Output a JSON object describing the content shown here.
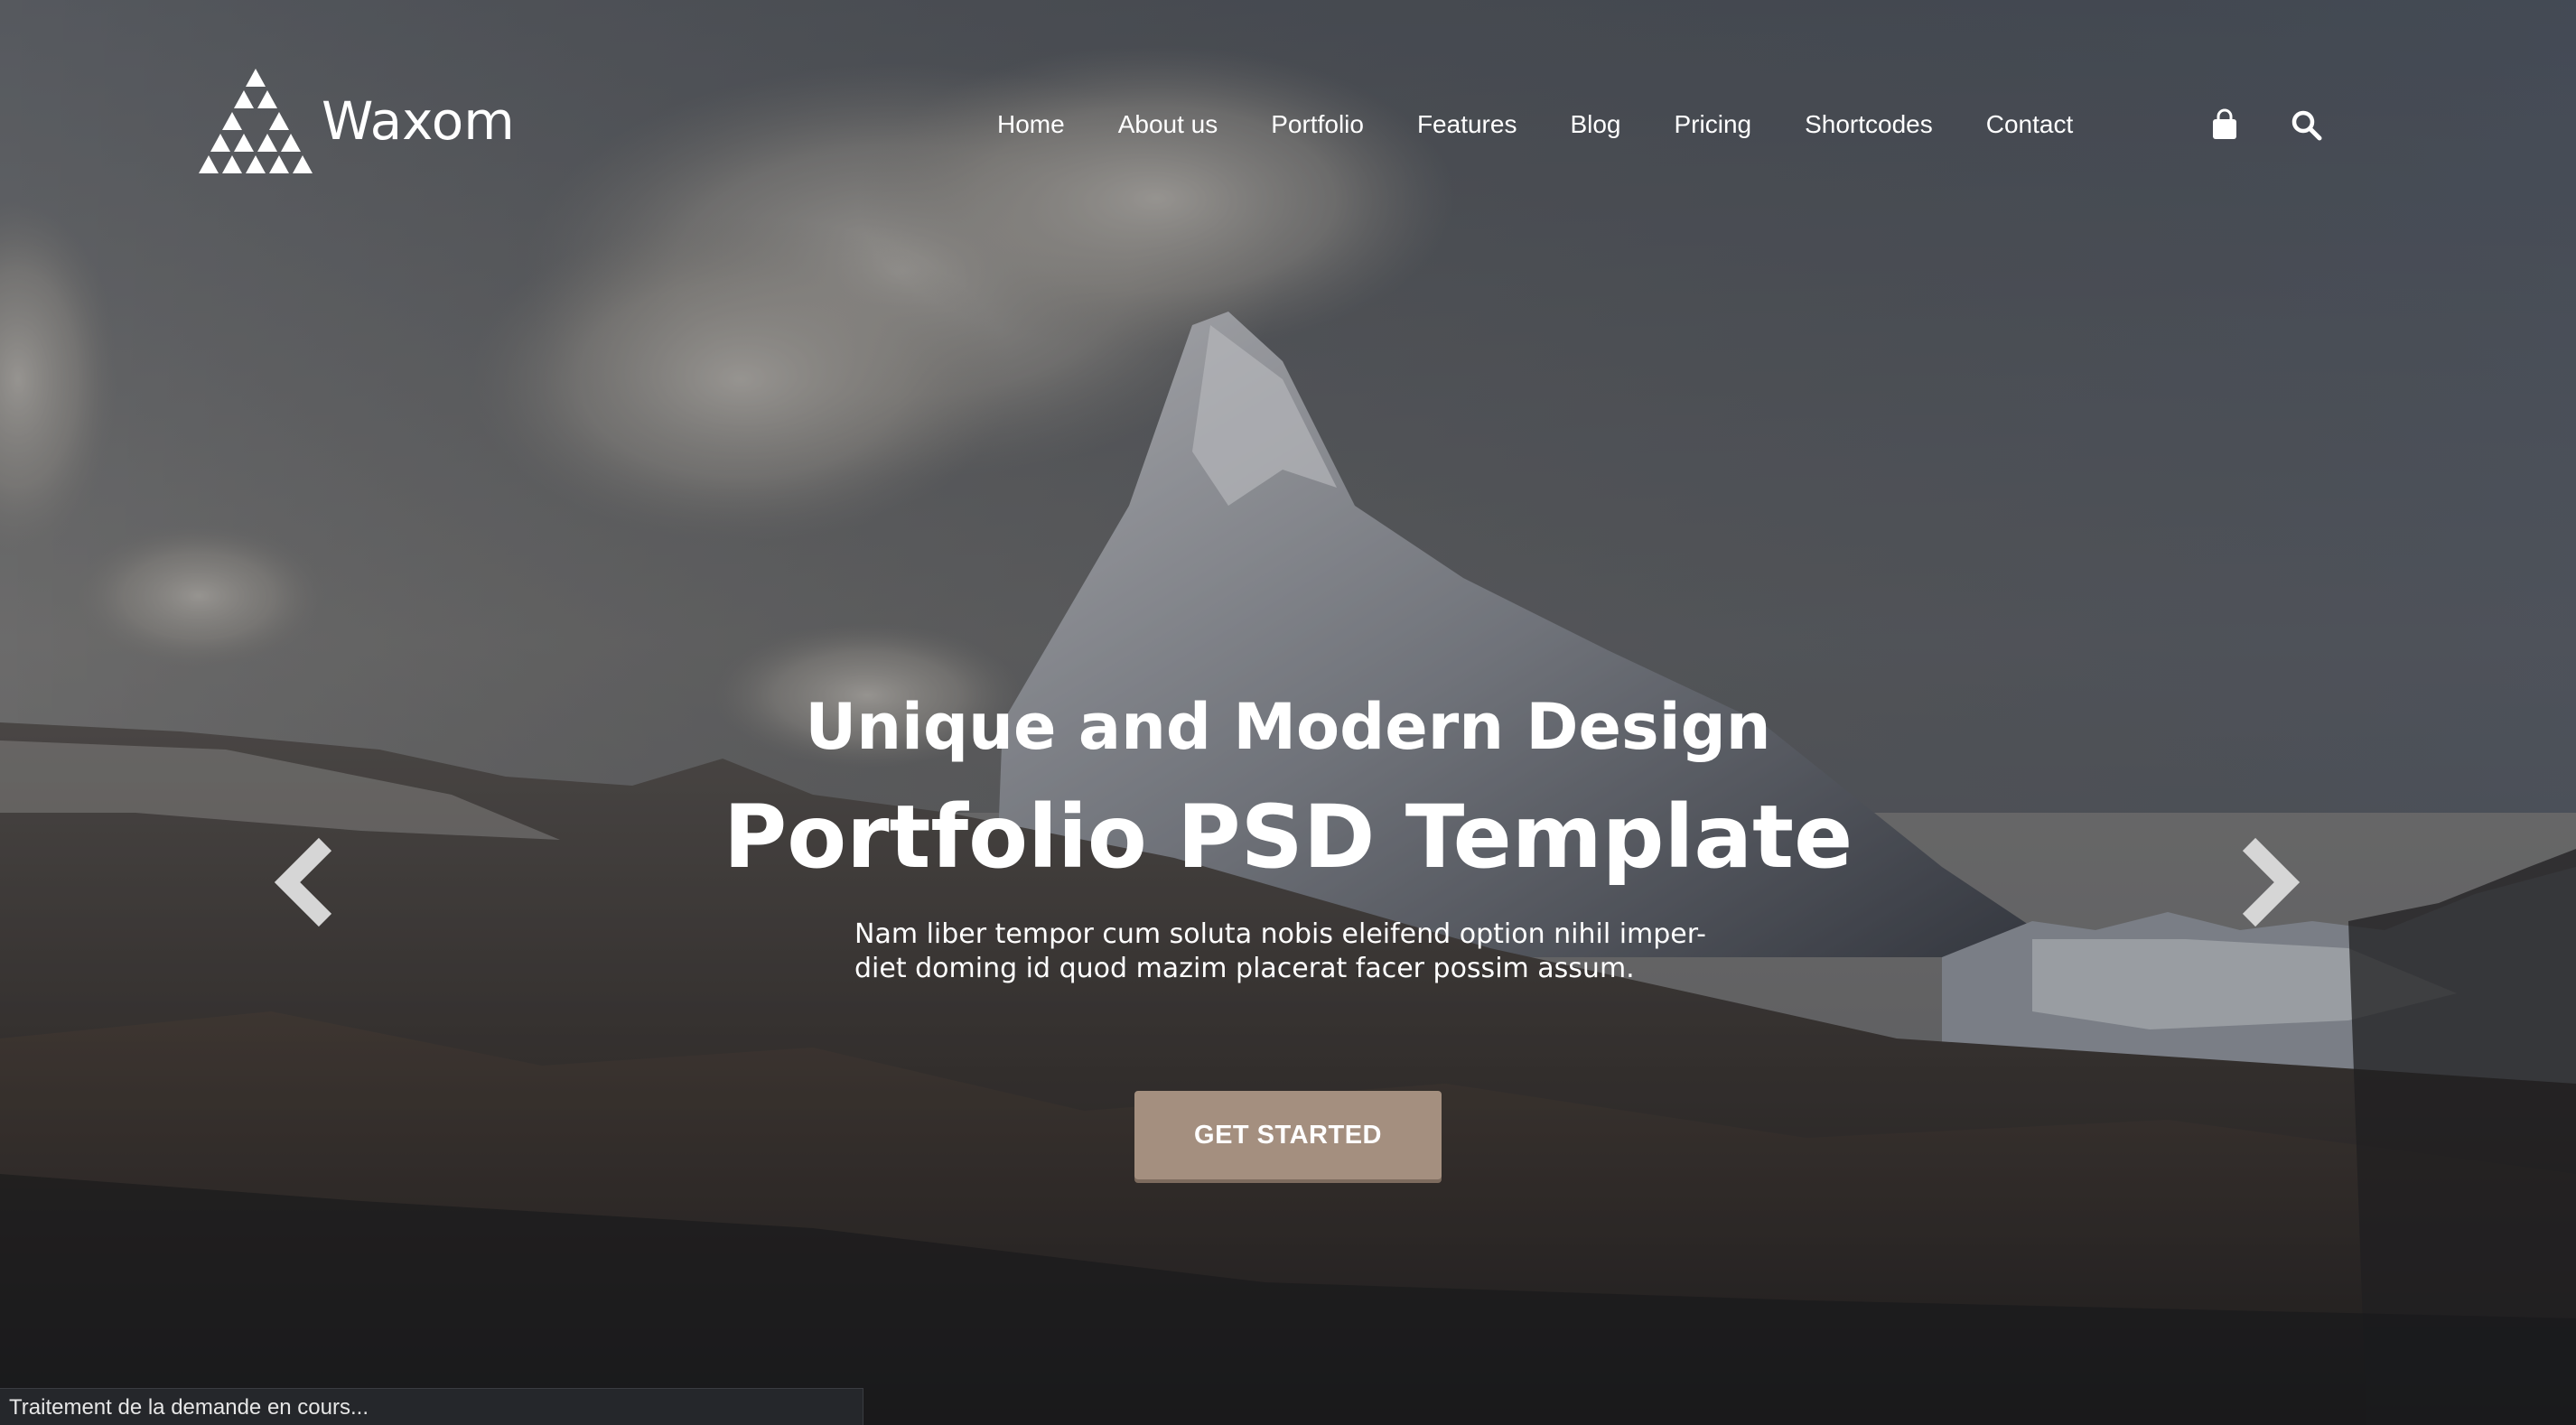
{
  "site": {
    "name": "Waxom"
  },
  "nav": {
    "items": [
      "Home",
      "About us",
      "Portfolio",
      "Features",
      "Blog",
      "Pricing",
      "Shortcodes",
      "Contact"
    ]
  },
  "header_icons": [
    "shopping-bag-icon",
    "search-icon"
  ],
  "hero": {
    "subtitle": "Unique and Modern Design",
    "title": "Portfolio PSD Template",
    "description_lines": [
      "Nam liber tempor cum soluta nobis eleifend option nihil imper-",
      "diet doming id quod mazim placerat facer possim assum."
    ],
    "cta_label": "GET STARTED",
    "prev_icon": "chevron-left-icon",
    "next_icon": "chevron-right-icon"
  },
  "status_bar": {
    "text": "Traitement de la demande en cours..."
  },
  "colors": {
    "cta_background": "#a48f7f",
    "text": "#ffffff",
    "status_bar_background": "#25272b"
  }
}
